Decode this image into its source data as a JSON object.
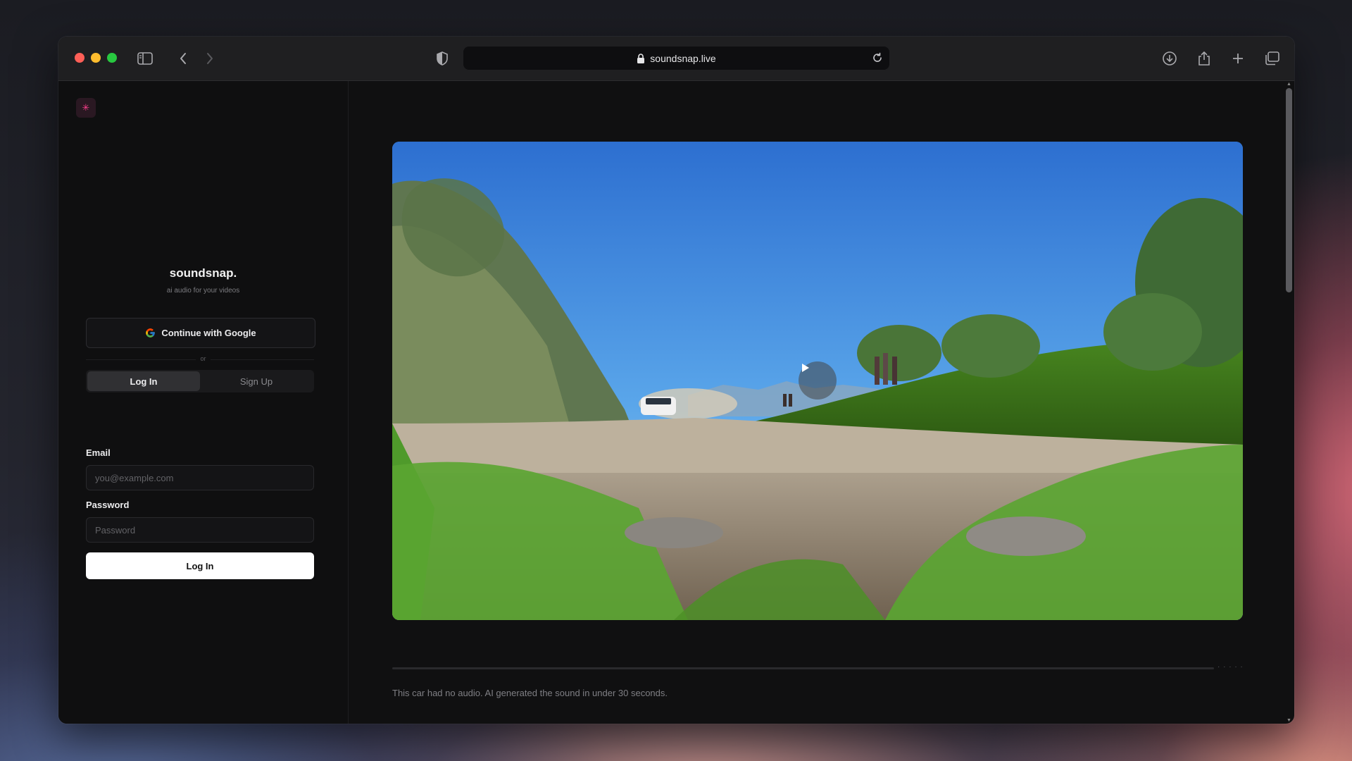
{
  "browser": {
    "url": "soundsnap.live",
    "icons": {
      "sidebar": "sidebar-icon",
      "back": "chevron-left-icon",
      "forward": "chevron-right-icon",
      "shield": "shield-icon",
      "lock": "lock-icon",
      "reload": "reload-icon",
      "download": "download-icon",
      "share": "share-icon",
      "new_tab": "plus-icon",
      "tabs": "tabs-overview-icon"
    }
  },
  "auth": {
    "logo_icon": "sparkle-icon",
    "brand": "soundsnap.",
    "tagline": "ai audio for your videos",
    "google_button": "Continue with Google",
    "or_label": "or",
    "tabs": {
      "login": "Log In",
      "signup": "Sign Up",
      "active": "login"
    },
    "email": {
      "label": "Email",
      "placeholder": "you@example.com",
      "value": ""
    },
    "password": {
      "label": "Password",
      "placeholder": "Password",
      "value": ""
    },
    "submit": "Log In"
  },
  "demo": {
    "play_icon": "play-icon",
    "caption": "This car had no audio. AI generated the sound in under 30 seconds.",
    "progress": 0
  },
  "colors": {
    "accent_pink": "#ff3f8e",
    "window_bg": "#101011",
    "button_white": "#ffffff"
  }
}
